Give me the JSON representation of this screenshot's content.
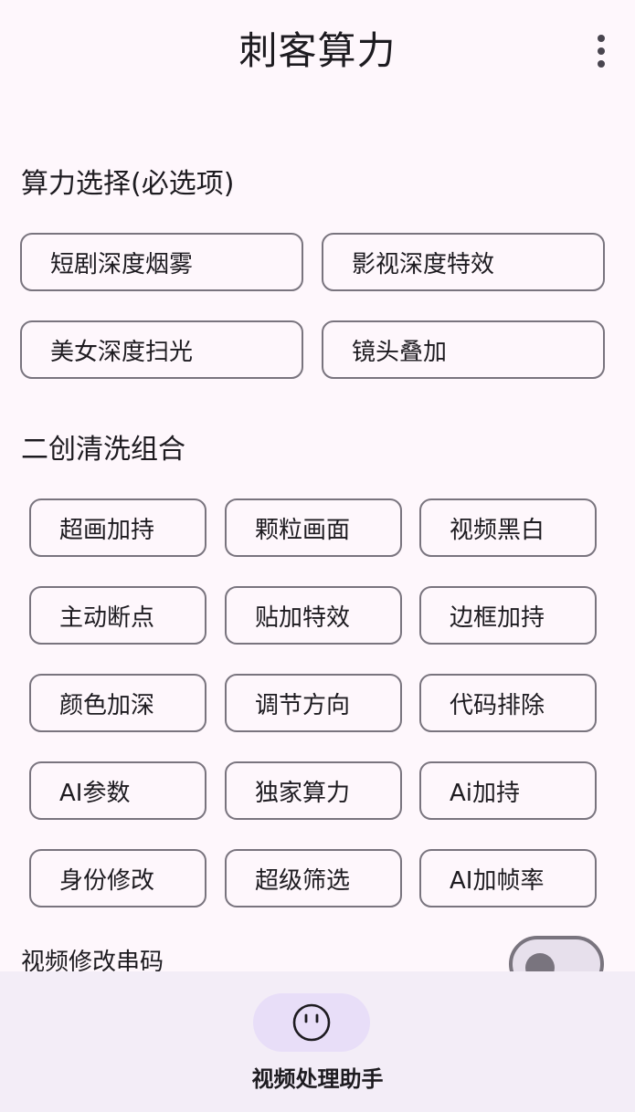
{
  "app_bar": {
    "title": "刺客算力",
    "menu_icon": "more-vert-icon"
  },
  "compute_section": {
    "title": "算力选择(必选项)",
    "options": [
      {
        "label": "短剧深度烟雾"
      },
      {
        "label": "影视深度特效"
      },
      {
        "label": "美女深度扫光"
      },
      {
        "label": "镜头叠加"
      }
    ]
  },
  "combo_section": {
    "title": "二创清洗组合",
    "options": [
      {
        "label": "超画加持"
      },
      {
        "label": "颗粒画面"
      },
      {
        "label": "视频黑白"
      },
      {
        "label": "主动断点"
      },
      {
        "label": "贴加特效"
      },
      {
        "label": "边框加持"
      },
      {
        "label": "颜色加深"
      },
      {
        "label": "调节方向"
      },
      {
        "label": "代码排除"
      },
      {
        "label": "AI参数"
      },
      {
        "label": "独家算力"
      },
      {
        "label": "Ai加持"
      },
      {
        "label": "身份修改"
      },
      {
        "label": "超级筛选"
      },
      {
        "label": "AI加帧率"
      }
    ]
  },
  "toggle_row": {
    "label": "视频修改串码",
    "checked": false
  },
  "bottom_nav": {
    "items": [
      {
        "label": "视频处理助手",
        "icon": "face-icon"
      }
    ]
  },
  "colors": {
    "background": "#fef7fc",
    "outline": "#79747e",
    "nav_background": "#f3edf7",
    "nav_indicator": "#e8def8",
    "text": "#1d1b20"
  }
}
